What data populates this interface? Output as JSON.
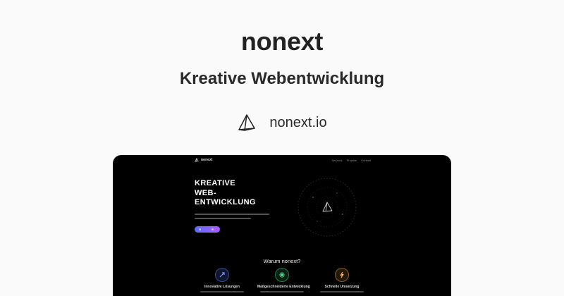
{
  "hero": {
    "title": "nonext",
    "tagline": "Kreative Webentwicklung",
    "domain": "nonext.io",
    "logo_icon": "pyramid-icon"
  },
  "preview": {
    "nav": {
      "logo_text": "nonext",
      "links": [
        "Services",
        "Projekte",
        "Kontakt"
      ]
    },
    "hero_lines": [
      "KREATIVE",
      "WEB-",
      "ENTWICKLUNG"
    ],
    "section_title": "Warum nonext?",
    "features": [
      {
        "title": "Innovative Lösungen",
        "icon": "rocket-icon",
        "color": "#5b7cff"
      },
      {
        "title": "Maßgeschneiderte Entwicklung",
        "icon": "sparkle-icon",
        "color": "#3ddc84"
      },
      {
        "title": "Schnelle Umsetzung",
        "icon": "bolt-icon",
        "color": "#f0a040"
      }
    ],
    "colors": {
      "background": "#000000",
      "cta_start": "#5a6bff",
      "cta_end": "#b05cff"
    }
  }
}
